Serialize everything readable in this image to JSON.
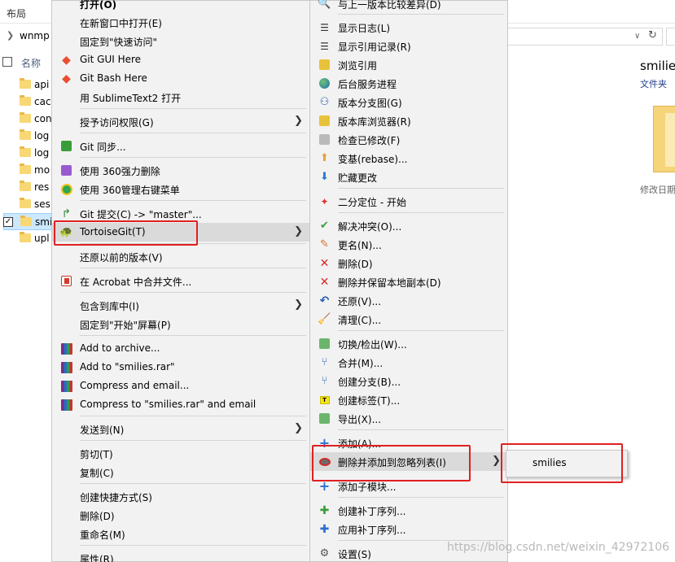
{
  "explorer": {
    "ribbon_tab": "布局",
    "address": "wnmp",
    "column_name": "名称",
    "files": [
      "api",
      "cac",
      "con",
      "log",
      "log",
      "mo",
      "res",
      "ses",
      "smi",
      "upl"
    ],
    "selected_index": 8,
    "preview_title": "smilie",
    "preview_type": "文件夹",
    "preview_date": "修改日期"
  },
  "main_menu": {
    "items": [
      {
        "label": "打开(O)",
        "icon": "none",
        "bold": true
      },
      {
        "label": "在新窗口中打开(E)",
        "icon": "none"
      },
      {
        "label": "固定到\"快速访问\"",
        "icon": "none"
      },
      {
        "label": "Git GUI Here",
        "icon": "git-diamond-icon"
      },
      {
        "label": "Git Bash Here",
        "icon": "git-diamond-icon"
      },
      {
        "label": "用 SublimeText2 打开",
        "icon": "none"
      },
      {
        "label": "授予访问权限(G)",
        "icon": "none",
        "submenu": true
      },
      {
        "label": "Git 同步...",
        "icon": "git-sync-icon"
      },
      {
        "label": "使用 360强力删除",
        "icon": "shred-icon"
      },
      {
        "label": "使用 360管理右键菜单",
        "icon": "360-icon"
      },
      {
        "label": "Git 提交(C) -> \"master\"...",
        "icon": "git-commit-icon"
      },
      {
        "label": "TortoiseGit(T)",
        "icon": "tortoise-icon",
        "submenu": true,
        "highlighted": true
      },
      {
        "label": "还原以前的版本(V)",
        "icon": "none"
      },
      {
        "label": "在 Acrobat 中合并文件...",
        "icon": "acrobat-icon"
      },
      {
        "label": "包含到库中(I)",
        "icon": "none",
        "submenu": true
      },
      {
        "label": "固定到\"开始\"屏幕(P)",
        "icon": "none"
      },
      {
        "label": "Add to archive...",
        "icon": "winrar-icon"
      },
      {
        "label": "Add to \"smilies.rar\"",
        "icon": "winrar-icon"
      },
      {
        "label": "Compress and email...",
        "icon": "winrar-icon"
      },
      {
        "label": "Compress to \"smilies.rar\" and email",
        "icon": "winrar-icon"
      },
      {
        "label": "发送到(N)",
        "icon": "none",
        "submenu": true
      },
      {
        "label": "剪切(T)",
        "icon": "none"
      },
      {
        "label": "复制(C)",
        "icon": "none"
      },
      {
        "label": "创建快捷方式(S)",
        "icon": "none"
      },
      {
        "label": "删除(D)",
        "icon": "none"
      },
      {
        "label": "重命名(M)",
        "icon": "none"
      },
      {
        "label": "属性(R)",
        "icon": "none"
      }
    ]
  },
  "tortoise_menu": {
    "items": [
      {
        "label": "与上一版本比较差异(D)",
        "icon": "diff-icon"
      },
      {
        "label": "显示日志(L)",
        "icon": "log-icon"
      },
      {
        "label": "显示引用记录(R)",
        "icon": "reflog-icon"
      },
      {
        "label": "浏览引用",
        "icon": "browse-ref-icon"
      },
      {
        "label": "后台服务进程",
        "icon": "daemon-icon"
      },
      {
        "label": "版本分支图(G)",
        "icon": "revision-graph-icon"
      },
      {
        "label": "版本库浏览器(R)",
        "icon": "repo-browser-icon"
      },
      {
        "label": "检查已修改(F)",
        "icon": "check-modified-icon"
      },
      {
        "label": "变基(rebase)...",
        "icon": "rebase-icon"
      },
      {
        "label": "贮藏更改",
        "icon": "stash-icon"
      },
      {
        "label": "二分定位 - 开始",
        "icon": "bisect-icon"
      },
      {
        "label": "解决冲突(O)...",
        "icon": "resolve-icon"
      },
      {
        "label": "更名(N)...",
        "icon": "rename-icon"
      },
      {
        "label": "删除(D)",
        "icon": "delete-icon"
      },
      {
        "label": "删除并保留本地副本(D)",
        "icon": "delete-keep-icon"
      },
      {
        "label": "还原(V)...",
        "icon": "revert-icon"
      },
      {
        "label": "清理(C)...",
        "icon": "cleanup-icon"
      },
      {
        "label": "切换/检出(W)...",
        "icon": "switch-icon"
      },
      {
        "label": "合并(M)...",
        "icon": "merge-icon"
      },
      {
        "label": "创建分支(B)...",
        "icon": "branch-icon"
      },
      {
        "label": "创建标签(T)...",
        "icon": "tag-icon"
      },
      {
        "label": "导出(X)...",
        "icon": "export-icon"
      },
      {
        "label": "添加(A)...",
        "icon": "add-icon"
      },
      {
        "label": "删除并添加到忽略列表(I)",
        "icon": "ignore-icon",
        "submenu": true,
        "highlighted": true
      },
      {
        "label": "添加子模块...",
        "icon": "submodule-icon"
      },
      {
        "label": "创建补丁序列...",
        "icon": "create-patch-icon"
      },
      {
        "label": "应用补丁序列...",
        "icon": "apply-patch-icon"
      },
      {
        "label": "设置(S)",
        "icon": "settings-icon"
      }
    ]
  },
  "ignore_menu": {
    "items": [
      {
        "label": "smilies"
      }
    ]
  },
  "watermark": "https://blog.csdn.net/weixin_42972106",
  "colors": {
    "annotation": "#e02020",
    "menu_bg": "#f2f2f2",
    "highlight": "#dadada"
  }
}
